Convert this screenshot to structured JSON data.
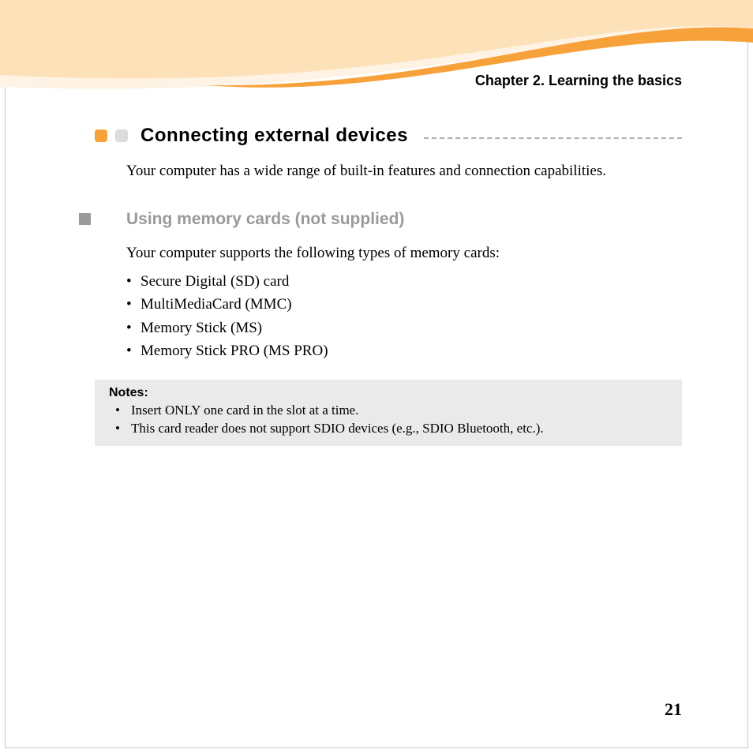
{
  "header": {
    "chapter": "Chapter 2. Learning the basics"
  },
  "section": {
    "title": "Connecting external devices",
    "intro": "Your computer has a wide range of built-in features and connection capabilities."
  },
  "subsection": {
    "title": "Using memory cards (not supplied)",
    "intro": "Your computer supports the following types of memory cards:",
    "cards": [
      "Secure Digital (SD) card",
      "MultiMediaCard (MMC)",
      "Memory Stick (MS)",
      "Memory Stick PRO (MS PRO)"
    ]
  },
  "notes": {
    "label": "Notes:",
    "items": [
      "Insert ONLY one card in the slot at a time.",
      "This card reader does not support SDIO devices (e.g., SDIO Bluetooth, etc.)."
    ]
  },
  "page_number": "21"
}
